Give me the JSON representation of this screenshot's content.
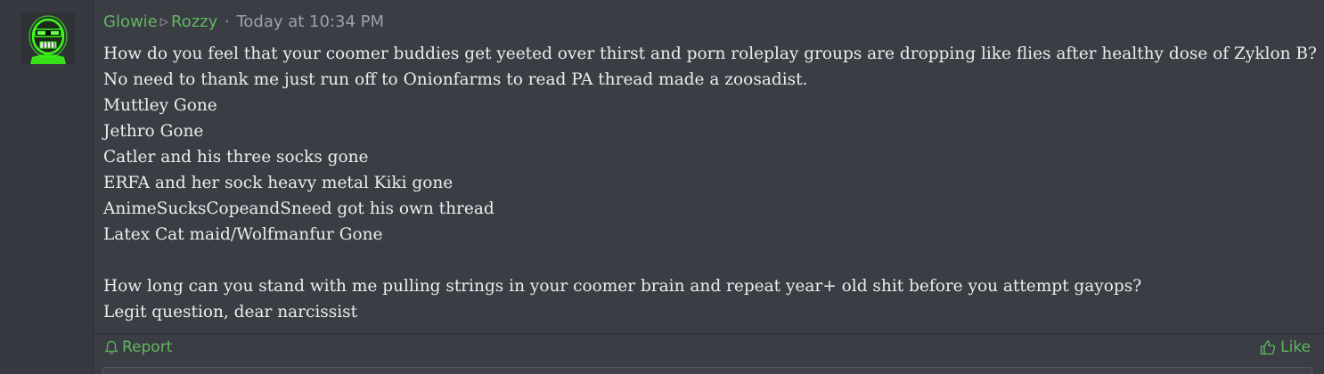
{
  "avatar": {
    "icon": "skull-avatar-icon",
    "accent": "#39ff14"
  },
  "meta": {
    "author": "Glowie",
    "recipient": "Rozzy",
    "separator": "·",
    "timestamp": "Today at 10:34 PM"
  },
  "message": {
    "lines": [
      "How do you feel that your coomer buddies get yeeted over thirst and porn roleplay groups are dropping like flies after healthy dose of Zyklon B?",
      "No need to thank me just run off to Onionfarms to read PA thread made a zoosadist.",
      "Muttley Gone",
      "Jethro Gone",
      "Catler and his three socks gone",
      "ERFA and her sock heavy metal Kiki gone",
      "AnimeSucksCopeandSneed got his own thread",
      "Latex Cat maid/Wolfmanfur Gone",
      "",
      "How long can you stand with me pulling strings in your coomer brain and repeat year+ old shit before you attempt gayops?",
      "Legit question, dear narcissist"
    ]
  },
  "actions": {
    "report_label": "Report",
    "like_label": "Like"
  },
  "colors": {
    "accent": "#5fb85d",
    "text": "#ececec",
    "muted": "#9ea2a8",
    "background": "#3a3d44"
  }
}
